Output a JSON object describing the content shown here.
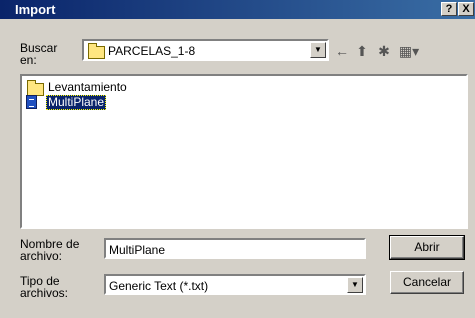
{
  "window": {
    "title": "Import",
    "help_button": "?",
    "close_button": "X"
  },
  "look_in": {
    "label": "Buscar en:",
    "value": "PARCELAS_1-8"
  },
  "toolbar": {
    "icons": [
      "back-arrow-icon",
      "up-folder-icon",
      "new-folder-icon",
      "view-menu-icon"
    ]
  },
  "files": [
    {
      "name": "Levantamiento",
      "icon": "folder-icon",
      "selected": false
    },
    {
      "name": "MultiPlane",
      "icon": "document-icon",
      "selected": true
    }
  ],
  "filename": {
    "label": "Nombre de archivo:",
    "value": "MultiPlane"
  },
  "filetype": {
    "label": "Tipo de archivos:",
    "value": "Generic Text (*.txt)"
  },
  "buttons": {
    "open": "Abrir",
    "cancel": "Cancelar"
  }
}
